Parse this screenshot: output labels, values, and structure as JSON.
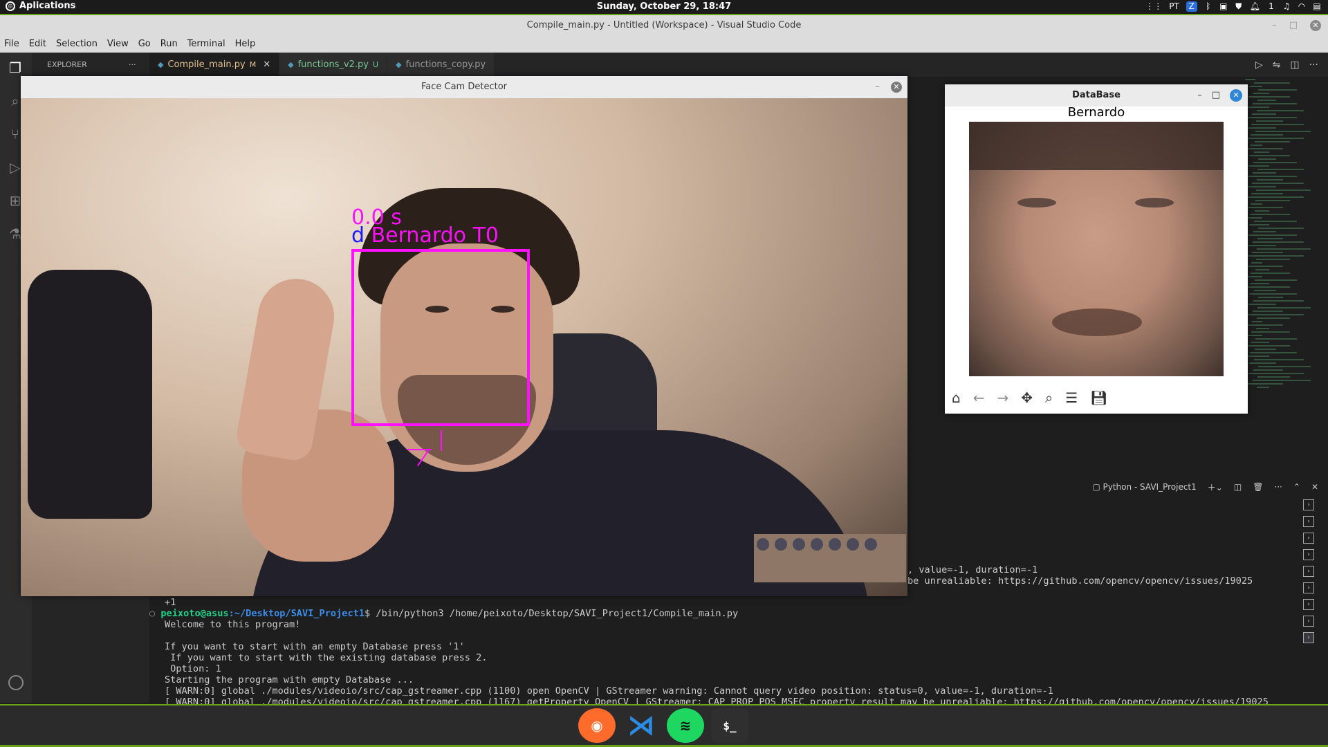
{
  "topbar": {
    "apps_label": "Aplications",
    "clock": "Sunday, October 29, 18:47",
    "tray": [
      "PT",
      "Z",
      "1"
    ]
  },
  "vscode": {
    "title": "Compile_main.py - Untitled (Workspace) - Visual Studio Code",
    "menu": [
      "File",
      "Edit",
      "Selection",
      "View",
      "Go",
      "Run",
      "Terminal",
      "Help"
    ],
    "explorer_label": "EXPLORER",
    "tabs": [
      {
        "label": "Compile_main.py",
        "badge": "M"
      },
      {
        "label": "functions_v2.py",
        "badge": "U"
      },
      {
        "label": "functions_copy.py",
        "badge": ""
      }
    ],
    "terminal_name": "Python - SAVI_Project1"
  },
  "terminal": {
    "right_lines": [
      ", value=-1, duration=-1",
      "be unrealiable: https://github.com/opencv/opencv/issues/19025"
    ],
    "plus_line": "+1",
    "prompt_user": "peixoto@asus",
    "prompt_path": ":~/Desktop/SAVI_Project1",
    "prompt_cmd": "$ /bin/python3 /home/peixoto/Desktop/SAVI_Project1/Compile_main.py",
    "lines": [
      "Welcome to this program!",
      "",
      "If you want to start with an empty Database press '1'",
      " If you want to start with the existing database press 2.",
      " Option: 1",
      "Starting the program with empty Database ...",
      "[ WARN:0] global ./modules/videoio/src/cap_gstreamer.cpp (1100) open OpenCV | GStreamer warning: Cannot query video position: status=0, value=-1, duration=-1",
      "[ WARN:0] global ./modules/videoio/src/cap_gstreamer.cpp (1167) getProperty OpenCV | GStreamer: CAP_PROP_POS_MSEC property result may be unrealiable: https://github.com/opencv/opencv/issues/19025"
    ]
  },
  "face_cam": {
    "title": "Face Cam Detector",
    "timer": "0.0 s",
    "label_prefix": "d",
    "label_name": " Bernardo T0",
    "colors": {
      "box": "#ff10ff",
      "prefix": "#1a1aff"
    }
  },
  "database": {
    "title": "DataBase",
    "person_name": "Bernardo",
    "toolbar": [
      "home-icon",
      "back-icon",
      "forward-icon",
      "pan-icon",
      "zoom-icon",
      "configure-icon",
      "save-icon"
    ]
  },
  "dock": {
    "terminal_glyph": "$_"
  }
}
